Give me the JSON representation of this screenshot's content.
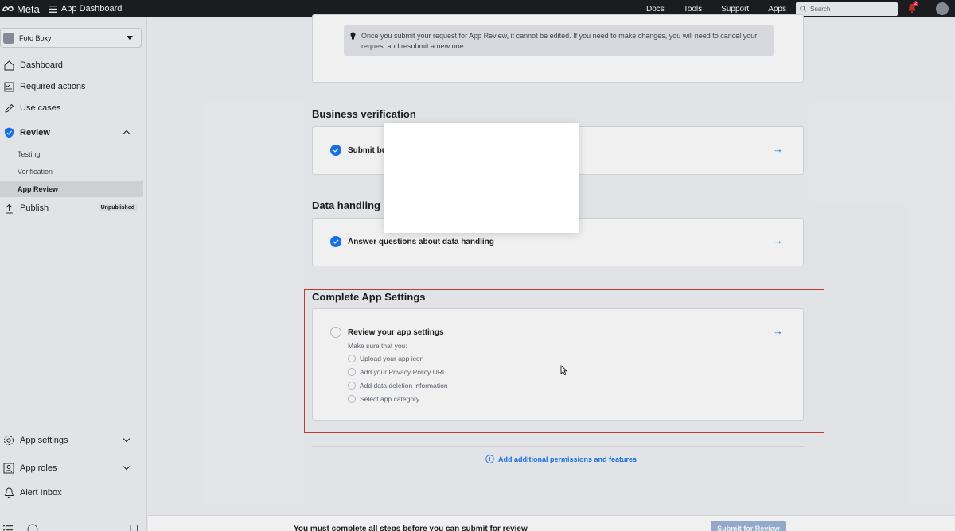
{
  "topbar": {
    "brand": "Meta",
    "title": "App Dashboard",
    "links": [
      "Docs",
      "Tools",
      "Support",
      "Apps"
    ],
    "search_placeholder": "Search",
    "notification_count": "2"
  },
  "sidebar": {
    "app_name": "Foto Boxy",
    "dashboard": "Dashboard",
    "required_actions": "Required actions",
    "use_cases": "Use cases",
    "review": "Review",
    "testing": "Testing",
    "verification": "Verification",
    "app_review": "App Review",
    "publish": "Publish",
    "publish_badge": "Unpublished",
    "app_settings": "App settings",
    "app_roles": "App roles",
    "alert_inbox": "Alert Inbox"
  },
  "main": {
    "info_text": "Once you submit your request for App Review, it cannot be edited. If you need to make changes, you will need to cancel your request and resubmit a new one.",
    "business_title": "Business verification",
    "business_item": "Submit bu",
    "data_title": "Data handling q",
    "data_item": "Answer questions about data handling",
    "complete_title": "Complete App Settings",
    "review_settings": "Review your app settings",
    "make_sure": "Make sure that you:",
    "checklist": [
      "Upload your app icon",
      "Add your Privacy Policy URL",
      "Add data deletion information",
      "Select app category"
    ],
    "add_permissions": "Add additional permissions and features"
  },
  "footer": {
    "message": "You must complete all steps before you can submit for review",
    "submit_label": "Submit for Review"
  },
  "colors": {
    "accent": "#1877f2",
    "highlight_border": "#c0392b",
    "topbar_bg": "#1c1e21"
  }
}
